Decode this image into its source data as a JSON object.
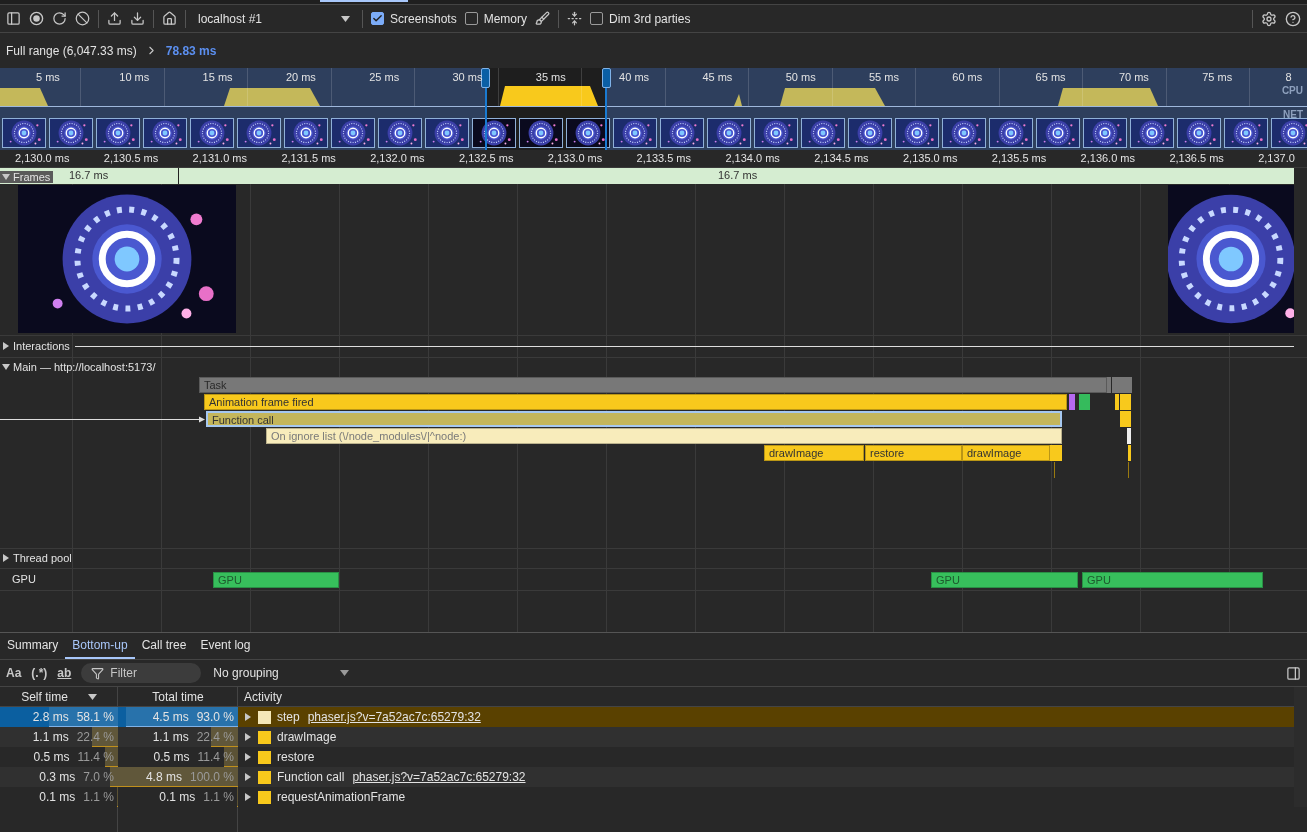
{
  "toolbar": {
    "target": "localhost #1",
    "options": [
      {
        "label": "Screenshots",
        "checked": true
      },
      {
        "label": "Memory",
        "checked": false
      },
      {
        "label": "Dim 3rd parties",
        "checked": false
      }
    ]
  },
  "breadcrumbs": [
    {
      "label": "Full range (6,047.33 ms)",
      "selected": false
    },
    {
      "label": "78.83 ms",
      "selected": true
    }
  ],
  "overview": {
    "ticks": [
      "5 ms",
      "10 ms",
      "15 ms",
      "20 ms",
      "25 ms",
      "30 ms",
      "35 ms",
      "40 ms",
      "45 ms",
      "50 ms",
      "55 ms",
      "60 ms",
      "65 ms",
      "70 ms",
      "75 ms",
      "8"
    ],
    "lanes": [
      "CPU",
      "NET"
    ]
  },
  "ruler": [
    "2,130.0 ms",
    "2,130.5 ms",
    "2,131.0 ms",
    "2,131.5 ms",
    "2,132.0 ms",
    "2,132.5 ms",
    "2,133.0 ms",
    "2,133.5 ms",
    "2,134.0 ms",
    "2,134.5 ms",
    "2,135.0 ms",
    "2,135.5 ms",
    "2,136.0 ms",
    "2,136.5 ms",
    "2,137.0"
  ],
  "tracks": {
    "frames": {
      "label": "Frames",
      "expanded": true,
      "durations": [
        "16.7 ms",
        "16.7 ms"
      ]
    },
    "interactions": {
      "label": "Interactions",
      "expanded": false
    },
    "main": {
      "label": "Main — http://localhost:5173/",
      "expanded": true,
      "events": [
        {
          "label": "Task",
          "kind": "task",
          "selected": false
        },
        {
          "label": "Animation frame fired",
          "kind": "frame",
          "selected": false
        },
        {
          "label": "Function call",
          "kind": "call",
          "selected": true
        },
        {
          "label": "On ignore list (\\/node_modules\\/|^node:)",
          "kind": "ignored",
          "selected": false
        },
        {
          "label": "drawImage",
          "kind": "draw",
          "selected": false
        },
        {
          "label": "restore",
          "kind": "draw",
          "selected": false
        },
        {
          "label": "drawImage",
          "kind": "draw",
          "selected": false
        }
      ]
    },
    "thread_pool": {
      "label": "Thread pool",
      "expanded": false
    },
    "gpu": {
      "label": "GPU",
      "events": [
        "GPU",
        "GPU",
        "GPU"
      ]
    }
  },
  "details": {
    "tabs": [
      {
        "label": "Summary",
        "selected": false
      },
      {
        "label": "Bottom-up",
        "selected": true
      },
      {
        "label": "Call tree",
        "selected": false
      },
      {
        "label": "Event log",
        "selected": false
      }
    ],
    "match_buttons": [
      "Aa",
      "(.*)",
      "ab"
    ],
    "filter": {
      "placeholder": "Filter"
    },
    "grouping": "No grouping",
    "columns": [
      "Self time",
      "Total time",
      "Activity"
    ],
    "rows": [
      {
        "self": {
          "time": "2.8 ms",
          "percent": "58.1 %",
          "level": 0.581
        },
        "total": {
          "time": "4.5 ms",
          "percent": "93.0 %",
          "level": 0.93
        },
        "activity": "step",
        "source": "phaser.js?v=7a52ac7c:65279:32",
        "color": "#f5e8b8",
        "expanded": false,
        "selected": true
      },
      {
        "self": {
          "time": "1.1 ms",
          "percent": "22.4 %",
          "level": 0.224
        },
        "total": {
          "time": "1.1 ms",
          "percent": "22.4 %",
          "level": 0.224
        },
        "activity": "drawImage",
        "color": "#f8c91c",
        "expanded": false,
        "selected": false
      },
      {
        "self": {
          "time": "0.5 ms",
          "percent": "11.4 %",
          "level": 0.114
        },
        "total": {
          "time": "0.5 ms",
          "percent": "11.4 %",
          "level": 0.114
        },
        "activity": "restore",
        "color": "#f8c91c",
        "expanded": false,
        "selected": false
      },
      {
        "self": {
          "time": "0.3 ms",
          "percent": "7.0 %",
          "level": 0.07
        },
        "total": {
          "time": "4.8 ms",
          "percent": "100.0 %",
          "level": 1
        },
        "activity": "Function call",
        "source": "phaser.js?v=7a52ac7c:65279:32",
        "color": "#f8c91c",
        "expanded": false,
        "selected": false
      },
      {
        "self": {
          "time": "0.1 ms",
          "percent": "1.1 %",
          "level": 0.011
        },
        "total": {
          "time": "0.1 ms",
          "percent": "1.1 %",
          "level": 0.011
        },
        "activity": "requestAnimationFrame",
        "color": "#f8c91c",
        "expanded": false,
        "selected": false
      }
    ]
  }
}
